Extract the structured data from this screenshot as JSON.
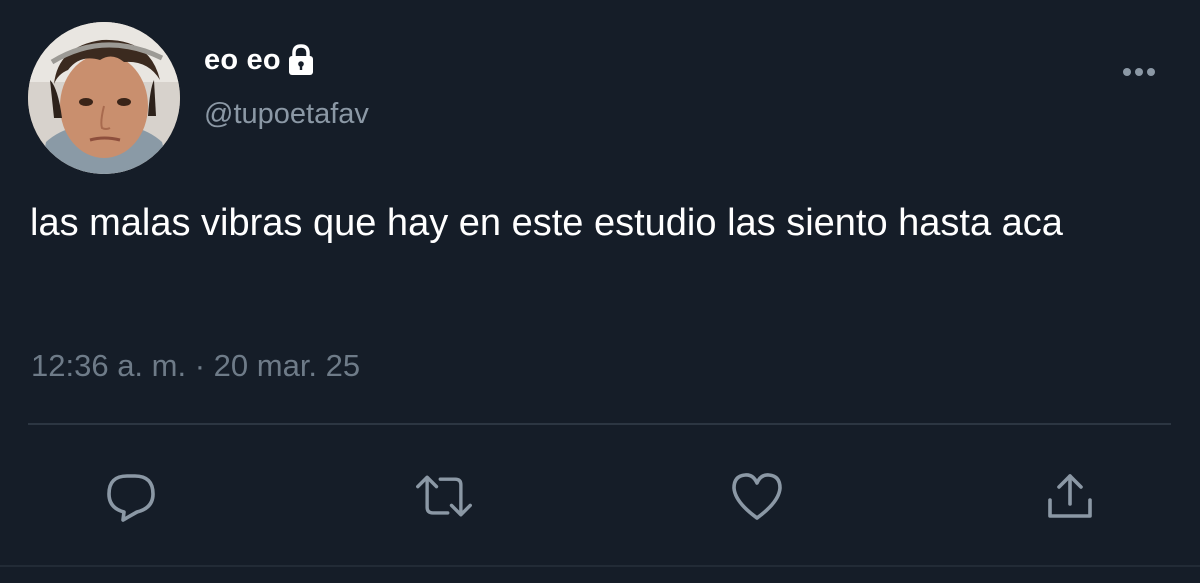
{
  "tweet": {
    "display_name": "eo eo",
    "handle": "@tupoetafav",
    "text": "las malas vibras que hay en este estudio las siento hasta aca",
    "time": "12:36 a. m.",
    "separator": " · ",
    "date": "20 mar. 25"
  },
  "icons": {
    "protected": "lock-icon",
    "more": "more-options-icon",
    "reply": "reply-icon",
    "retweet": "retweet-icon",
    "like": "like-icon",
    "share": "share-icon"
  },
  "colors": {
    "background": "#151d28",
    "text": "#ffffff",
    "secondary_text": "#8b98a5",
    "icon": "#8b98a5",
    "divider": "#2c3642"
  }
}
